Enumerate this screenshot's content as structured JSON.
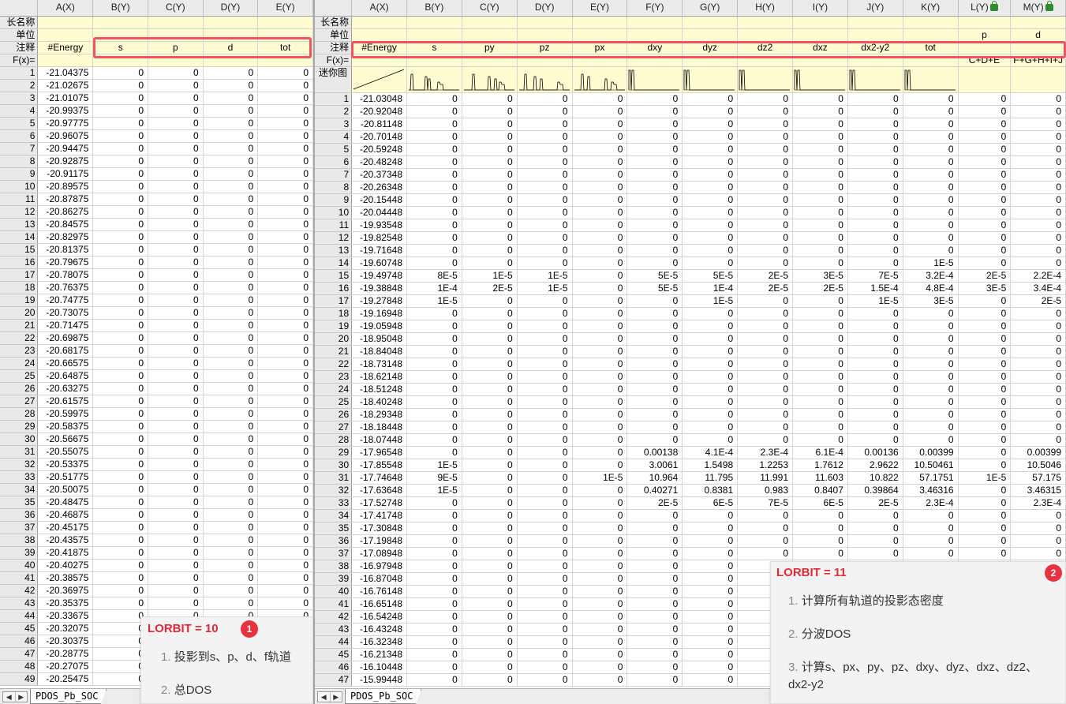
{
  "left_sheet": {
    "columns": [
      "A(X)",
      "B(Y)",
      "C(Y)",
      "D(Y)",
      "E(Y)"
    ],
    "meta_rows": [
      {
        "label": "长名称",
        "values": [
          "",
          "",
          "",
          "",
          ""
        ]
      },
      {
        "label": "单位",
        "values": [
          "",
          "",
          "",
          "",
          ""
        ]
      },
      {
        "label": "注释",
        "values": [
          "#Energy",
          "s",
          "p",
          "d",
          "tot"
        ]
      },
      {
        "label": "F(x)=",
        "values": [
          "",
          "",
          "",
          "",
          ""
        ]
      }
    ],
    "energies": [
      "-21.04375",
      "-21.02675",
      "-21.01075",
      "-20.99375",
      "-20.97775",
      "-20.96075",
      "-20.94475",
      "-20.92875",
      "-20.91175",
      "-20.89575",
      "-20.87875",
      "-20.86275",
      "-20.84575",
      "-20.82975",
      "-20.81375",
      "-20.79675",
      "-20.78075",
      "-20.76375",
      "-20.74775",
      "-20.73075",
      "-20.71475",
      "-20.69875",
      "-20.68175",
      "-20.66575",
      "-20.64875",
      "-20.63275",
      "-20.61575",
      "-20.59975",
      "-20.58375",
      "-20.56675",
      "-20.55075",
      "-20.53375",
      "-20.51775",
      "-20.50075",
      "-20.48475",
      "-20.46875",
      "-20.45175",
      "-20.43575",
      "-20.41875",
      "-20.40275",
      "-20.38575",
      "-20.36975",
      "-20.35375",
      "-20.33675",
      "-20.32075",
      "-20.30375",
      "-20.28775",
      "-20.27075",
      "-20.25475"
    ],
    "sheet_tab": "PDOS_Pb_SOC"
  },
  "right_sheet": {
    "columns": [
      "A(X)",
      "B(Y)",
      "C(Y)",
      "D(Y)",
      "E(Y)",
      "F(Y)",
      "G(Y)",
      "H(Y)",
      "I(Y)",
      "J(Y)",
      "K(Y)",
      "L(Y)",
      "M(Y)"
    ],
    "locked_columns": [
      "L(Y)",
      "M(Y)"
    ],
    "meta_rows": [
      {
        "label": "长名称",
        "values": [
          "",
          "",
          "",
          "",
          "",
          "",
          "",
          "",
          "",
          "",
          "",
          "",
          ""
        ]
      },
      {
        "label": "单位",
        "values": [
          "",
          "",
          "",
          "",
          "",
          "",
          "",
          "",
          "",
          "",
          "",
          "p",
          "d"
        ]
      },
      {
        "label": "注释",
        "values": [
          "#Energy",
          "s",
          "py",
          "pz",
          "px",
          "dxy",
          "dyz",
          "dz2",
          "dxz",
          "dx2-y2",
          "tot",
          "",
          ""
        ]
      },
      {
        "label": "F(x)=",
        "values": [
          "",
          "",
          "",
          "",
          "",
          "",
          "",
          "",
          "",
          "",
          "",
          "C+D+E",
          "F+G+H+I+J"
        ]
      }
    ],
    "sparkline_label": "迷你图",
    "rows": [
      [
        "-21.03048",
        "0",
        "0",
        "0",
        "0",
        "0",
        "0",
        "0",
        "0",
        "0",
        "0",
        "0",
        "0"
      ],
      [
        "-20.92048",
        "0",
        "0",
        "0",
        "0",
        "0",
        "0",
        "0",
        "0",
        "0",
        "0",
        "0",
        "0"
      ],
      [
        "-20.81148",
        "0",
        "0",
        "0",
        "0",
        "0",
        "0",
        "0",
        "0",
        "0",
        "0",
        "0",
        "0"
      ],
      [
        "-20.70148",
        "0",
        "0",
        "0",
        "0",
        "0",
        "0",
        "0",
        "0",
        "0",
        "0",
        "0",
        "0"
      ],
      [
        "-20.59248",
        "0",
        "0",
        "0",
        "0",
        "0",
        "0",
        "0",
        "0",
        "0",
        "0",
        "0",
        "0"
      ],
      [
        "-20.48248",
        "0",
        "0",
        "0",
        "0",
        "0",
        "0",
        "0",
        "0",
        "0",
        "0",
        "0",
        "0"
      ],
      [
        "-20.37348",
        "0",
        "0",
        "0",
        "0",
        "0",
        "0",
        "0",
        "0",
        "0",
        "0",
        "0",
        "0"
      ],
      [
        "-20.26348",
        "0",
        "0",
        "0",
        "0",
        "0",
        "0",
        "0",
        "0",
        "0",
        "0",
        "0",
        "0"
      ],
      [
        "-20.15448",
        "0",
        "0",
        "0",
        "0",
        "0",
        "0",
        "0",
        "0",
        "0",
        "0",
        "0",
        "0"
      ],
      [
        "-20.04448",
        "0",
        "0",
        "0",
        "0",
        "0",
        "0",
        "0",
        "0",
        "0",
        "0",
        "0",
        "0"
      ],
      [
        "-19.93548",
        "0",
        "0",
        "0",
        "0",
        "0",
        "0",
        "0",
        "0",
        "0",
        "0",
        "0",
        "0"
      ],
      [
        "-19.82548",
        "0",
        "0",
        "0",
        "0",
        "0",
        "0",
        "0",
        "0",
        "0",
        "0",
        "0",
        "0"
      ],
      [
        "-19.71648",
        "0",
        "0",
        "0",
        "0",
        "0",
        "0",
        "0",
        "0",
        "0",
        "0",
        "0",
        "0"
      ],
      [
        "-19.60748",
        "0",
        "0",
        "0",
        "0",
        "0",
        "0",
        "0",
        "0",
        "0",
        "1E-5",
        "0",
        "0"
      ],
      [
        "-19.49748",
        "8E-5",
        "1E-5",
        "1E-5",
        "0",
        "5E-5",
        "5E-5",
        "2E-5",
        "3E-5",
        "7E-5",
        "3.2E-4",
        "2E-5",
        "2.2E-4"
      ],
      [
        "-19.38848",
        "1E-4",
        "2E-5",
        "1E-5",
        "0",
        "5E-5",
        "1E-4",
        "2E-5",
        "2E-5",
        "1.5E-4",
        "4.8E-4",
        "3E-5",
        "3.4E-4"
      ],
      [
        "-19.27848",
        "1E-5",
        "0",
        "0",
        "0",
        "0",
        "1E-5",
        "0",
        "0",
        "1E-5",
        "3E-5",
        "0",
        "2E-5"
      ],
      [
        "-19.16948",
        "0",
        "0",
        "0",
        "0",
        "0",
        "0",
        "0",
        "0",
        "0",
        "0",
        "0",
        "0"
      ],
      [
        "-19.05948",
        "0",
        "0",
        "0",
        "0",
        "0",
        "0",
        "0",
        "0",
        "0",
        "0",
        "0",
        "0"
      ],
      [
        "-18.95048",
        "0",
        "0",
        "0",
        "0",
        "0",
        "0",
        "0",
        "0",
        "0",
        "0",
        "0",
        "0"
      ],
      [
        "-18.84048",
        "0",
        "0",
        "0",
        "0",
        "0",
        "0",
        "0",
        "0",
        "0",
        "0",
        "0",
        "0"
      ],
      [
        "-18.73148",
        "0",
        "0",
        "0",
        "0",
        "0",
        "0",
        "0",
        "0",
        "0",
        "0",
        "0",
        "0"
      ],
      [
        "-18.62148",
        "0",
        "0",
        "0",
        "0",
        "0",
        "0",
        "0",
        "0",
        "0",
        "0",
        "0",
        "0"
      ],
      [
        "-18.51248",
        "0",
        "0",
        "0",
        "0",
        "0",
        "0",
        "0",
        "0",
        "0",
        "0",
        "0",
        "0"
      ],
      [
        "-18.40248",
        "0",
        "0",
        "0",
        "0",
        "0",
        "0",
        "0",
        "0",
        "0",
        "0",
        "0",
        "0"
      ],
      [
        "-18.29348",
        "0",
        "0",
        "0",
        "0",
        "0",
        "0",
        "0",
        "0",
        "0",
        "0",
        "0",
        "0"
      ],
      [
        "-18.18448",
        "0",
        "0",
        "0",
        "0",
        "0",
        "0",
        "0",
        "0",
        "0",
        "0",
        "0",
        "0"
      ],
      [
        "-18.07448",
        "0",
        "0",
        "0",
        "0",
        "0",
        "0",
        "0",
        "0",
        "0",
        "0",
        "0",
        "0"
      ],
      [
        "-17.96548",
        "0",
        "0",
        "0",
        "0",
        "0.00138",
        "4.1E-4",
        "2.3E-4",
        "6.1E-4",
        "0.00136",
        "0.00399",
        "0",
        "0.00399"
      ],
      [
        "-17.85548",
        "1E-5",
        "0",
        "0",
        "0",
        "3.0061",
        "1.5498",
        "1.2253",
        "1.7612",
        "2.9622",
        "10.50461",
        "0",
        "10.5046"
      ],
      [
        "-17.74648",
        "9E-5",
        "0",
        "0",
        "1E-5",
        "10.964",
        "11.795",
        "11.991",
        "11.603",
        "10.822",
        "57.1751",
        "1E-5",
        "57.175"
      ],
      [
        "-17.63648",
        "1E-5",
        "0",
        "0",
        "0",
        "0.40271",
        "0.8381",
        "0.983",
        "0.8407",
        "0.39864",
        "3.46316",
        "0",
        "3.46315"
      ],
      [
        "-17.52748",
        "0",
        "0",
        "0",
        "0",
        "2E-5",
        "6E-5",
        "7E-5",
        "6E-5",
        "2E-5",
        "2.3E-4",
        "0",
        "2.3E-4"
      ],
      [
        "-17.41748",
        "0",
        "0",
        "0",
        "0",
        "0",
        "0",
        "0",
        "0",
        "0",
        "0",
        "0",
        "0"
      ],
      [
        "-17.30848",
        "0",
        "0",
        "0",
        "0",
        "0",
        "0",
        "0",
        "0",
        "0",
        "0",
        "0",
        "0"
      ],
      [
        "-17.19848",
        "0",
        "0",
        "0",
        "0",
        "0",
        "0",
        "0",
        "0",
        "0",
        "0",
        "0",
        "0"
      ],
      [
        "-17.08948",
        "0",
        "0",
        "0",
        "0",
        "0",
        "0",
        "0",
        "0",
        "0",
        "0",
        "0",
        "0"
      ],
      [
        "-16.97948",
        "0",
        "0",
        "0",
        "0",
        "0",
        "0",
        "",
        "",
        "",
        "",
        "",
        ""
      ],
      [
        "-16.87048",
        "0",
        "0",
        "0",
        "0",
        "0",
        "0",
        "",
        "",
        "",
        "",
        "",
        ""
      ],
      [
        "-16.76148",
        "0",
        "0",
        "0",
        "0",
        "0",
        "0",
        "",
        "",
        "",
        "",
        "",
        ""
      ],
      [
        "-16.65148",
        "0",
        "0",
        "0",
        "0",
        "0",
        "0",
        "",
        "",
        "",
        "",
        "",
        ""
      ],
      [
        "-16.54248",
        "0",
        "0",
        "0",
        "0",
        "0",
        "0",
        "",
        "",
        "",
        "",
        "",
        ""
      ],
      [
        "-16.43248",
        "0",
        "0",
        "0",
        "0",
        "0",
        "0",
        "",
        "",
        "",
        "",
        "",
        ""
      ],
      [
        "-16.32348",
        "0",
        "0",
        "0",
        "0",
        "0",
        "0",
        "",
        "",
        "",
        "",
        "",
        ""
      ],
      [
        "-16.21348",
        "0",
        "0",
        "0",
        "0",
        "0",
        "0",
        "",
        "",
        "",
        "",
        "",
        ""
      ],
      [
        "-16.10448",
        "0",
        "0",
        "0",
        "0",
        "0",
        "0",
        "",
        "",
        "",
        "",
        "",
        ""
      ],
      [
        "-15.99448",
        "0",
        "0",
        "0",
        "0",
        "0",
        "0",
        "",
        "",
        "",
        "",
        "",
        ""
      ]
    ],
    "sheet_tab": "PDOS_Pb_SOC"
  },
  "callout_1": {
    "title": "LORBIT = 10",
    "badge": "1",
    "items": [
      {
        "num": "1.",
        "text": "投影到s、p、d、f轨道"
      },
      {
        "num": "2.",
        "text": "总DOS"
      }
    ]
  },
  "callout_2": {
    "title": "LORBIT = 11",
    "badge": "2",
    "items": [
      {
        "num": "1.",
        "text": "计算所有轨道的投影态密度"
      },
      {
        "num": "2.",
        "text": "分波DOS"
      },
      {
        "num": "3.",
        "text": "计算s、px、py、pz、dxy、dyz、dxz、dz2、dx2-y2"
      }
    ]
  },
  "colors": {
    "highlight": "#ee5461",
    "meta_bg": "#fffcd2",
    "badge": "#e8323f",
    "callout_title": "#e02a3a"
  }
}
